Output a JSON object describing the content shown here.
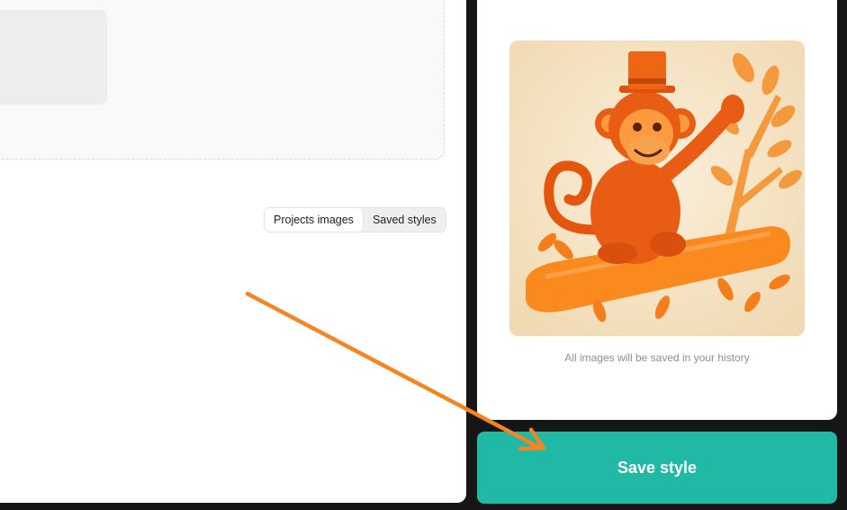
{
  "left_panel": {
    "tabs": [
      {
        "label": "Projects images",
        "active": true
      },
      {
        "label": "Saved styles",
        "active": false
      }
    ]
  },
  "preview": {
    "image_subject": "monkey-in-top-hat-on-branch-illustration",
    "caption": "All images will be saved in your history"
  },
  "actions": {
    "save_label": "Save style"
  },
  "colors": {
    "accent": "#20b9a6",
    "annotation_arrow": "#f5861f",
    "background": "#161616"
  }
}
